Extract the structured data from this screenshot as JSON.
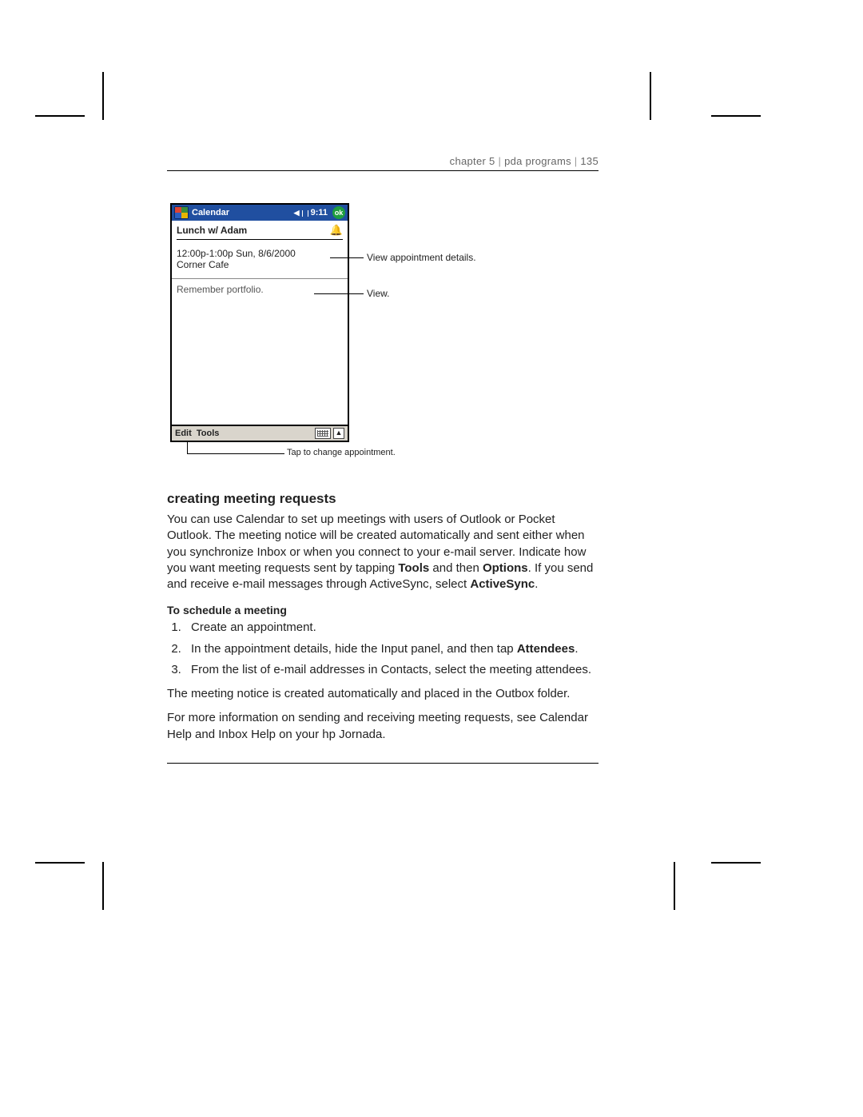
{
  "header": {
    "chapter": "chapter 5",
    "section": "pda programs",
    "page": "135"
  },
  "pda": {
    "title": "Calendar",
    "time": "9:11",
    "ok": "ok",
    "subject": "Lunch w/ Adam",
    "datetime": "12:00p-1:00p Sun, 8/6/2000",
    "location": "Corner Cafe",
    "note": "Remember portfolio.",
    "menu_edit": "Edit",
    "menu_tools": "Tools"
  },
  "callouts": {
    "details": "View appointment details.",
    "viewnote": "View.",
    "tap_edit": "Tap to change appointment."
  },
  "text": {
    "h3": "creating meeting requests",
    "p1a": "You can use Calendar to set up meetings with users of Outlook or Pocket Outlook. The meeting notice will be created automatically and sent either when you synchronize Inbox or when you connect to your e-mail server. Indicate how you want meeting requests sent by tapping ",
    "p1b": "Tools",
    "p1c": " and then ",
    "p1d": "Options",
    "p1e": ". If you send and receive e-mail messages through ActiveSync, select ",
    "p1f": "ActiveSync",
    "p1g": ".",
    "h4": "To schedule a meeting",
    "step1": "Create an appointment.",
    "step2a": "In the appointment details, hide the Input panel, and then tap ",
    "step2b": "Attendees",
    "step2c": ".",
    "step3": "From the list of e-mail addresses in Contacts, select the meeting attendees.",
    "p2": "The meeting notice is created automatically and placed in the Outbox folder.",
    "p3": "For more information on sending and receiving meeting requests, see Calendar Help and Inbox Help on your hp Jornada."
  }
}
